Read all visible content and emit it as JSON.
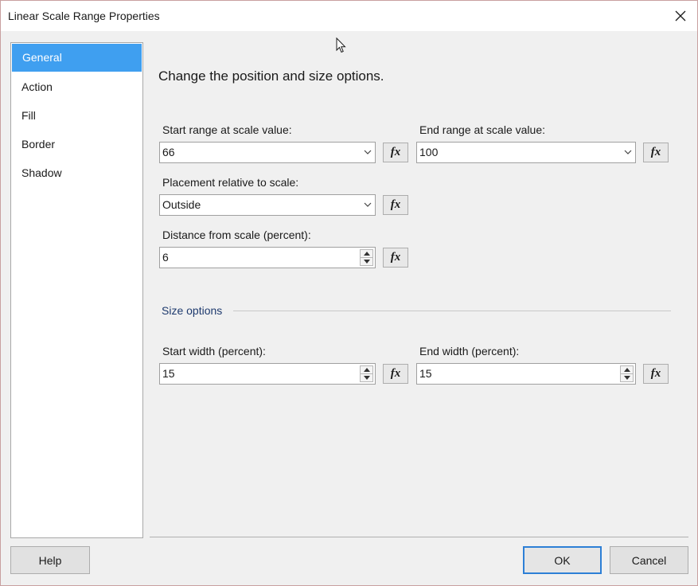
{
  "window": {
    "title": "Linear Scale Range Properties"
  },
  "nav": {
    "items": [
      {
        "label": "General",
        "selected": true
      },
      {
        "label": "Action"
      },
      {
        "label": "Fill"
      },
      {
        "label": "Border"
      },
      {
        "label": "Shadow"
      }
    ]
  },
  "main": {
    "heading": "Change the position and size options.",
    "start_range": {
      "label": "Start range at scale value:",
      "value": "66"
    },
    "end_range": {
      "label": "End range at scale value:",
      "value": "100"
    },
    "placement": {
      "label": "Placement relative to scale:",
      "value": "Outside"
    },
    "distance": {
      "label": "Distance from scale (percent):",
      "value": "6"
    },
    "size_section": {
      "label": "Size options"
    },
    "start_width": {
      "label": "Start width (percent):",
      "value": "15"
    },
    "end_width": {
      "label": "End width (percent):",
      "value": "15"
    },
    "fx_label": "fx"
  },
  "footer": {
    "help_label": "Help",
    "ok_label": "OK",
    "cancel_label": "Cancel"
  },
  "colors": {
    "selected_nav": "#3f9ff0",
    "primary_button_border": "#2d7fd6",
    "section_label": "#1e3a6e"
  }
}
